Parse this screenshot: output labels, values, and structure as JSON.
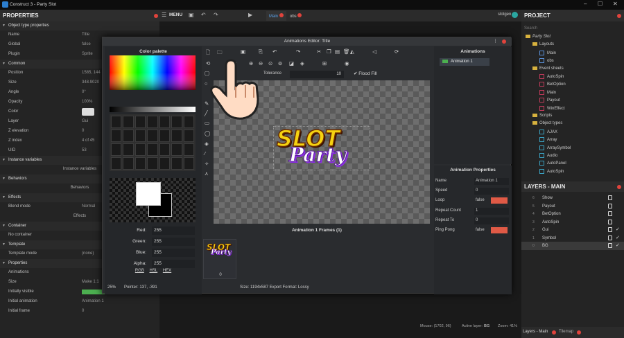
{
  "app": {
    "title": "Construct 3 - Party Slot"
  },
  "toolbar": {
    "menu_label": "MENU",
    "tabs": [
      "Main",
      "obs"
    ],
    "user": "slotgen"
  },
  "properties": {
    "title": "PROPERTIES",
    "rows": [
      {
        "type": "sec",
        "label": "Object type properties"
      },
      {
        "type": "row",
        "label": "Name",
        "value": "Title"
      },
      {
        "type": "row",
        "label": "Global",
        "value": "false"
      },
      {
        "type": "row",
        "label": "Plugin",
        "value": "Sprite"
      },
      {
        "type": "sec",
        "label": "Common"
      },
      {
        "type": "row",
        "label": "Position",
        "value": "1585, 144"
      },
      {
        "type": "row",
        "label": "Size",
        "value": "348.9020"
      },
      {
        "type": "row",
        "label": "Angle",
        "value": "0°"
      },
      {
        "type": "row",
        "label": "Opacity",
        "value": "100%"
      },
      {
        "type": "row",
        "label": "Color",
        "value": ""
      },
      {
        "type": "row",
        "label": "Layer",
        "value": "Gui"
      },
      {
        "type": "row",
        "label": "Z elevation",
        "value": "0"
      },
      {
        "type": "row",
        "label": "Z index",
        "value": "4 of 45"
      },
      {
        "type": "row",
        "label": "UID",
        "value": "53"
      },
      {
        "type": "sec",
        "label": "Instance variables"
      },
      {
        "type": "ctr",
        "label": "Instance variables"
      },
      {
        "type": "sec",
        "label": "Behaviors"
      },
      {
        "type": "ctr",
        "label": "Behaviors"
      },
      {
        "type": "sec",
        "label": "Effects"
      },
      {
        "type": "row",
        "label": "Blend mode",
        "value": "Normal"
      },
      {
        "type": "ctr",
        "label": "Effects"
      },
      {
        "type": "sec",
        "label": "Container"
      },
      {
        "type": "row",
        "label": "No container",
        "value": ""
      },
      {
        "type": "sec",
        "label": "Template"
      },
      {
        "type": "row",
        "label": "Template mode",
        "value": "(none)"
      },
      {
        "type": "sec",
        "label": "Properties"
      },
      {
        "type": "row",
        "label": "Animations",
        "value": ""
      },
      {
        "type": "row",
        "label": "Size",
        "value": "Make 1:1"
      },
      {
        "type": "row",
        "label": "Initially visible",
        "value": "true"
      },
      {
        "type": "row",
        "label": "Initial animation",
        "value": "Animation 1"
      },
      {
        "type": "row",
        "label": "Initial frame",
        "value": "0"
      }
    ]
  },
  "project": {
    "title": "PROJECT",
    "search_placeholder": "Search",
    "tree": [
      {
        "label": "Party Slot",
        "kind": "folder",
        "indent": 0
      },
      {
        "label": "Layouts",
        "kind": "folder",
        "indent": 1
      },
      {
        "label": "Main",
        "kind": "layout",
        "indent": 2
      },
      {
        "label": "obs",
        "kind": "layout",
        "indent": 2
      },
      {
        "label": "Event sheets",
        "kind": "folder",
        "indent": 1
      },
      {
        "label": "AutoSpin",
        "kind": "event",
        "indent": 2
      },
      {
        "label": "BetOption",
        "kind": "event",
        "indent": 2
      },
      {
        "label": "Main",
        "kind": "event",
        "indent": 2
      },
      {
        "label": "Payout",
        "kind": "event",
        "indent": 2
      },
      {
        "label": "WinEffect",
        "kind": "event",
        "indent": 2
      },
      {
        "label": "Scripts",
        "kind": "folder",
        "indent": 1
      },
      {
        "label": "Object types",
        "kind": "folder",
        "indent": 1
      },
      {
        "label": "AJAX",
        "kind": "obj",
        "indent": 2
      },
      {
        "label": "Array",
        "kind": "obj",
        "indent": 2
      },
      {
        "label": "ArraySymbol",
        "kind": "obj",
        "indent": 2
      },
      {
        "label": "Audio",
        "kind": "obj",
        "indent": 2
      },
      {
        "label": "AutoPanel",
        "kind": "obj",
        "indent": 2
      },
      {
        "label": "AutoSpin",
        "kind": "obj",
        "indent": 2
      }
    ]
  },
  "layers": {
    "title": "LAYERS - MAIN",
    "items": [
      {
        "num": "6",
        "name": "Show",
        "visible": false
      },
      {
        "num": "5",
        "name": "Payout",
        "visible": false
      },
      {
        "num": "4",
        "name": "BetOption",
        "visible": false
      },
      {
        "num": "3",
        "name": "AutoSpin",
        "visible": false
      },
      {
        "num": "2",
        "name": "Gui",
        "visible": true
      },
      {
        "num": "1",
        "name": "Symbol",
        "visible": true
      },
      {
        "num": "0",
        "name": "BG",
        "visible": true
      }
    ]
  },
  "bottom_tabs": [
    "Layers - Main",
    "Tilemap"
  ],
  "status": {
    "mouse": "Mouse: (1702, 96)",
    "active_layer_label": "Active layer:",
    "active_layer": "BG",
    "zoom": "Zoom: 41%"
  },
  "anim_editor": {
    "title": "Animations Editor: Title",
    "palette_label": "Color palette",
    "tolerance_label": "Tolerance",
    "tolerance_value": "10",
    "flood_fill_label": "Flood Fill",
    "rgba": [
      {
        "label": "Red:",
        "value": "255"
      },
      {
        "label": "Green:",
        "value": "255"
      },
      {
        "label": "Blue:",
        "value": "255"
      },
      {
        "label": "Alpha:",
        "value": "255"
      }
    ],
    "modes": [
      "RGB",
      "HSL",
      "HEX"
    ],
    "zoom": "25%",
    "pointer": "Pointer: 137, -391",
    "frames_label": "Animation 1 Frames (1)",
    "frame_index": "0",
    "size_info": "Size: 1194x587    Export Format: Lossy",
    "animations_label": "Animations",
    "animation_item": "Animation 1",
    "logo_word1": "SLOT",
    "logo_word2": "Party",
    "props_label": "Animation Properties",
    "props": [
      {
        "label": "Name",
        "value": "Animation 1",
        "toggle": false
      },
      {
        "label": "Speed",
        "value": "0",
        "toggle": false
      },
      {
        "label": "Loop",
        "value": "false",
        "toggle": true
      },
      {
        "label": "Repeat Count",
        "value": "1",
        "toggle": false
      },
      {
        "label": "Repeat To",
        "value": "0",
        "toggle": false
      },
      {
        "label": "Ping Pong",
        "value": "false",
        "toggle": true
      }
    ]
  },
  "colors": {
    "accent": "#e0433c",
    "toggle": "#e05a46",
    "anim_green": "#4caf50",
    "folder": "#d8b23e"
  }
}
